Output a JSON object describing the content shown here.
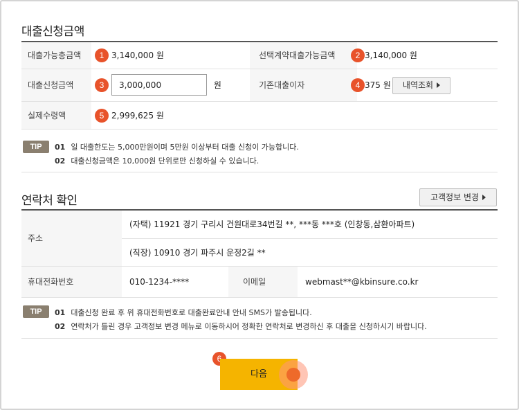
{
  "loan_section": {
    "title": "대출신청금액",
    "rows": {
      "available_total": {
        "label": "대출가능총금액",
        "badge": "1",
        "value": "3,140,000 원"
      },
      "selected_contract": {
        "label": "선택계약대출가능금액",
        "badge": "2",
        "value": "3,140,000 원"
      },
      "apply_amount": {
        "label": "대출신청금액",
        "badge": "3",
        "input_value": "3,000,000",
        "unit": "원"
      },
      "existing_interest": {
        "label": "기존대출이자",
        "badge": "4",
        "value": "375 원",
        "button_label": "내역조회"
      },
      "net_received": {
        "label": "실제수령액",
        "badge": "5",
        "value": "2,999,625 원"
      }
    },
    "tip": {
      "badge": "TIP",
      "items": [
        {
          "no": "01",
          "text": "일 대출한도는 5,000만원이며 5만원 이상부터 대출 신청이 가능합니다."
        },
        {
          "no": "02",
          "text": "대출신청금액은 10,000원 단위로만 신청하실 수 있습니다."
        }
      ]
    }
  },
  "contact_section": {
    "title": "연락처 확인",
    "edit_button_label": "고객정보 변경",
    "address_label": "주소",
    "address_home": "(자택) 11921 경기 구리시 건원대로34번길 **, ***동 ***호 (인창동,삼환아파트)",
    "address_work": "(직장) 10910 경기 파주시 운정2길 **",
    "mobile_label": "휴대전화번호",
    "mobile_value": "010-1234-****",
    "email_label": "이메일",
    "email_value": "webmast**@kbinsure.co.kr",
    "tip": {
      "badge": "TIP",
      "items": [
        {
          "no": "01",
          "text": "대출신청 완료 후 위 휴대전화번호로 대출완료안내 안내 SMS가 발송됩니다."
        },
        {
          "no": "02",
          "text": "연락처가 틀린 경우 고객정보 변경 메뉴로 이동하시어 정확한 연락처로 변경하신 후 대출을 신청하시기 바랍니다."
        }
      ]
    }
  },
  "footer": {
    "next_badge": "6",
    "next_button_label": "다음"
  },
  "colors": {
    "badge": "#e8532b",
    "next_button": "#f5b400",
    "tip_badge": "#8a7f6f"
  }
}
